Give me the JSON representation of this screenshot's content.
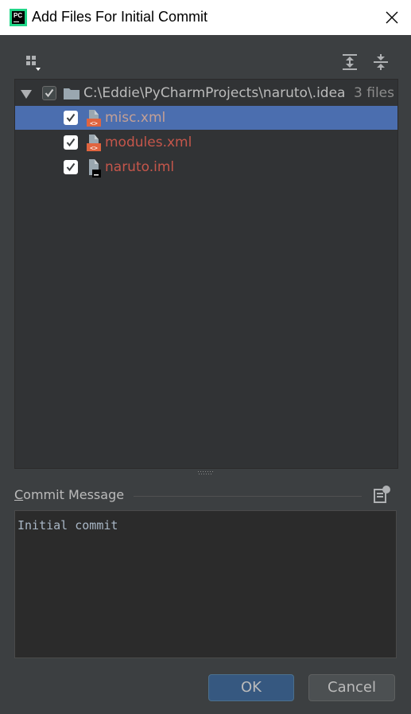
{
  "window": {
    "title": "Add Files For Initial Commit",
    "app_logo_text": "PC"
  },
  "toolbar": {
    "group_by_icon": "group-by-icon",
    "expand_all_icon": "expand-all-icon",
    "collapse_all_icon": "collapse-all-icon"
  },
  "tree": {
    "root": {
      "path": "C:\\Eddie\\PyCharmProjects\\naruto\\.idea",
      "count": "3 files",
      "checked": true
    },
    "files": [
      {
        "name": "misc.xml",
        "type": "xml",
        "checked": true,
        "selected": true
      },
      {
        "name": "modules.xml",
        "type": "xml",
        "checked": true,
        "selected": false
      },
      {
        "name": "naruto.iml",
        "type": "iml",
        "checked": true,
        "selected": false
      }
    ]
  },
  "commit": {
    "label_first": "C",
    "label_rest": "ommit Message",
    "message": "Initial commit"
  },
  "buttons": {
    "ok": "OK",
    "cancel": "Cancel"
  },
  "colors": {
    "background": "#3c3f41",
    "tree_background": "#313335",
    "selection": "#4b6eaf",
    "new_file_text": "#c5564b",
    "ok_button": "#365880"
  }
}
